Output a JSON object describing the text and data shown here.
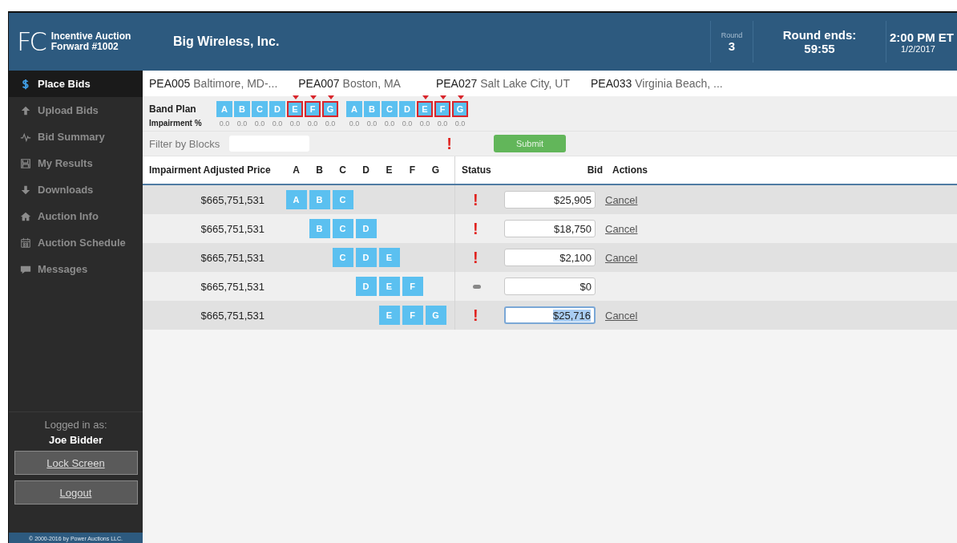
{
  "header": {
    "logo": "FC",
    "auction_name": "Incentive Auction",
    "auction_id": "Forward #1002",
    "bidder": "Big Wireless, Inc.",
    "round_label": "Round",
    "round": "3",
    "ends_label": "Round ends:",
    "ends_value": "59:55",
    "end_time": "2:00 PM ET",
    "end_date": "1/2/2017"
  },
  "sidebar": {
    "items": [
      {
        "label": "Place Bids",
        "kind": "dollar",
        "selected": true
      },
      {
        "label": "Upload Bids",
        "kind": "up",
        "selected": false
      },
      {
        "label": "Bid Summary",
        "kind": "pulse",
        "selected": false
      },
      {
        "label": "My Results",
        "kind": "disk",
        "selected": false
      },
      {
        "label": "Downloads",
        "kind": "down",
        "selected": false
      },
      {
        "label": "Auction Info",
        "kind": "home",
        "selected": false
      },
      {
        "label": "Auction Schedule",
        "kind": "calendar",
        "selected": false
      },
      {
        "label": "Messages",
        "kind": "chat",
        "selected": false
      }
    ],
    "logged_in_label": "Logged in as:",
    "user": "Joe Bidder",
    "buttons": [
      "Lock Screen",
      "Logout"
    ],
    "footer": "© 2000-2016 by Power Auctions LLC."
  },
  "areas": [
    {
      "code": "PEA005",
      "name": "Baltimore, MD-..."
    },
    {
      "code": "PEA007",
      "name": "Boston, MA"
    },
    {
      "code": "PEA027",
      "name": "Salt Lake City, UT"
    },
    {
      "code": "PEA033",
      "name": "Virginia Beach, ..."
    }
  ],
  "band_plan": {
    "label": "Band Plan",
    "impairment_label": "Impairment %",
    "groups": [
      [
        {
          "label": "A",
          "impairment": "0.0",
          "flagged": false
        },
        {
          "label": "B",
          "impairment": "0.0",
          "flagged": false
        },
        {
          "label": "C",
          "impairment": "0.0",
          "flagged": false
        },
        {
          "label": "D",
          "impairment": "0.0",
          "flagged": false
        },
        {
          "label": "E",
          "impairment": "0.0",
          "flagged": true
        },
        {
          "label": "F",
          "impairment": "0.0",
          "flagged": true
        },
        {
          "label": "G",
          "impairment": "0.0",
          "flagged": true
        }
      ],
      [
        {
          "label": "A",
          "impairment": "0.0",
          "flagged": false
        },
        {
          "label": "B",
          "impairment": "0.0",
          "flagged": false
        },
        {
          "label": "C",
          "impairment": "0.0",
          "flagged": false
        },
        {
          "label": "D",
          "impairment": "0.0",
          "flagged": false
        },
        {
          "label": "E",
          "impairment": "0.0",
          "flagged": true
        },
        {
          "label": "F",
          "impairment": "0.0",
          "flagged": true
        },
        {
          "label": "G",
          "impairment": "0.0",
          "flagged": true
        }
      ]
    ]
  },
  "filter": {
    "label": "Filter by Blocks",
    "warning": "!",
    "submit": "Submit"
  },
  "table": {
    "columns": {
      "price": "Impairment Adjusted Price",
      "blocks": [
        "A",
        "B",
        "C",
        "D",
        "E",
        "F",
        "G"
      ],
      "status": "Status",
      "bid": "Bid",
      "actions": "Actions"
    },
    "rows": [
      {
        "price": "$665,751,531",
        "blocks": [
          {
            "on": true,
            "label": "A"
          },
          {
            "on": true,
            "label": "B"
          },
          {
            "on": true,
            "label": "C"
          },
          {
            "on": false
          },
          {
            "on": false
          },
          {
            "on": false
          },
          {
            "on": false
          }
        ],
        "status": {
          "kind": "warning",
          "symbol": "!"
        },
        "bid": "$25,905",
        "highlighted": false,
        "action": "Cancel"
      },
      {
        "price": "$665,751,531",
        "blocks": [
          {
            "on": false
          },
          {
            "on": true,
            "label": "B"
          },
          {
            "on": true,
            "label": "C"
          },
          {
            "on": true,
            "label": "D"
          },
          {
            "on": false
          },
          {
            "on": false
          },
          {
            "on": false
          }
        ],
        "status": {
          "kind": "warning",
          "symbol": "!"
        },
        "bid": "$18,750",
        "highlighted": false,
        "action": "Cancel"
      },
      {
        "price": "$665,751,531",
        "blocks": [
          {
            "on": false
          },
          {
            "on": false
          },
          {
            "on": true,
            "label": "C"
          },
          {
            "on": true,
            "label": "D"
          },
          {
            "on": true,
            "label": "E"
          },
          {
            "on": false
          },
          {
            "on": false
          }
        ],
        "status": {
          "kind": "warning",
          "symbol": "!"
        },
        "bid": "$2,100",
        "highlighted": false,
        "action": "Cancel"
      },
      {
        "price": "$665,751,531",
        "blocks": [
          {
            "on": false
          },
          {
            "on": false
          },
          {
            "on": false
          },
          {
            "on": true,
            "label": "D"
          },
          {
            "on": true,
            "label": "E"
          },
          {
            "on": true,
            "label": "F"
          },
          {
            "on": false
          }
        ],
        "status": {
          "kind": "none"
        },
        "bid": "$0",
        "highlighted": false
      },
      {
        "price": "$665,751,531",
        "blocks": [
          {
            "on": false
          },
          {
            "on": false
          },
          {
            "on": false
          },
          {
            "on": false
          },
          {
            "on": true,
            "label": "E"
          },
          {
            "on": true,
            "label": "F"
          },
          {
            "on": true,
            "label": "G"
          }
        ],
        "status": {
          "kind": "warning",
          "symbol": "!"
        },
        "bid": "$25,716",
        "highlighted": true,
        "action": "Cancel"
      }
    ]
  }
}
